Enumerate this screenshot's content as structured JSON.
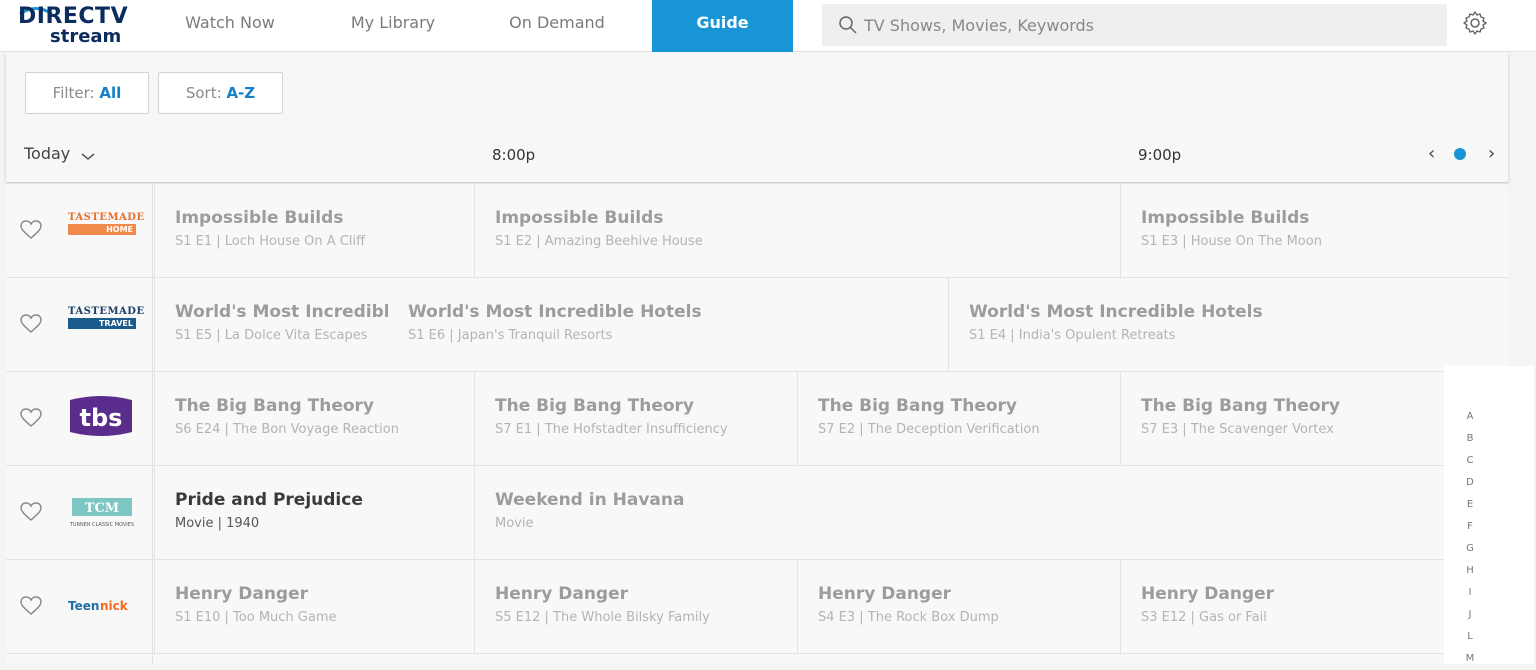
{
  "brand": {
    "line1": "DIRECTV",
    "line2": "stream"
  },
  "nav": {
    "watch_now": "Watch Now",
    "my_library": "My Library",
    "on_demand": "On Demand",
    "guide": "Guide"
  },
  "search": {
    "placeholder": "TV Shows, Movies, Keywords"
  },
  "controls": {
    "filter_label": "Filter:",
    "filter_value": "All",
    "sort_label": "Sort:",
    "sort_value": "A-Z",
    "day": "Today",
    "times": [
      "8:00p",
      "9:00p"
    ]
  },
  "rows": [
    {
      "channel": "TASTEMADE HOME",
      "programs": [
        {
          "title": "Impossible Builds",
          "sub": "S1 E1 | Loch House On A Cliff"
        },
        {
          "title": "Impossible Builds",
          "sub": "S1 E2 | Amazing Beehive House"
        },
        {
          "title": "Impossible Builds",
          "sub": "S1 E3 | House On The Moon"
        }
      ]
    },
    {
      "channel": "TASTEMADE TRAVEL",
      "programs": [
        {
          "title": "World's Most Incredible",
          "sub": "S1 E5 | La Dolce Vita Escapes"
        },
        {
          "title": "World's Most Incredible Hotels",
          "sub": "S1 E6 | Japan's Tranquil Resorts"
        },
        {
          "title": "World's Most Incredible Hotels",
          "sub": "S1 E4 | India's Opulent Retreats"
        }
      ]
    },
    {
      "channel": "tbs",
      "programs": [
        {
          "title": "The Big Bang Theory",
          "sub": "S6 E24 | The Bon Voyage Reaction"
        },
        {
          "title": "The Big Bang Theory",
          "sub": "S7 E1 | The Hofstadter Insufficiency"
        },
        {
          "title": "The Big Bang Theory",
          "sub": "S7 E2 | The Deception Verification"
        },
        {
          "title": "The Big Bang Theory",
          "sub": "S7 E3 | The Scavenger Vortex"
        }
      ]
    },
    {
      "channel": "TCM TURNER CLASSIC MOVIES",
      "programs": [
        {
          "title": "Pride and Prejudice",
          "sub": "Movie | 1940"
        },
        {
          "title": "Weekend in Havana",
          "sub": "Movie"
        }
      ]
    },
    {
      "channel": "TeenNick",
      "programs": [
        {
          "title": "Henry Danger",
          "sub": "S1 E10 | Too Much Game"
        },
        {
          "title": "Henry Danger",
          "sub": "S5 E12 | The Whole Bilsky Family"
        },
        {
          "title": "Henry Danger",
          "sub": "S4 E3 | The Rock Box Dump"
        },
        {
          "title": "Henry Danger",
          "sub": "S3 E12 | Gas or Fail"
        }
      ]
    }
  ],
  "alpha_index": [
    "A",
    "B",
    "C",
    "D",
    "E",
    "F",
    "G",
    "H",
    "I",
    "J",
    "L",
    "M"
  ],
  "colors": {
    "accent": "#1795d5",
    "brand": "#0b2c5e"
  }
}
